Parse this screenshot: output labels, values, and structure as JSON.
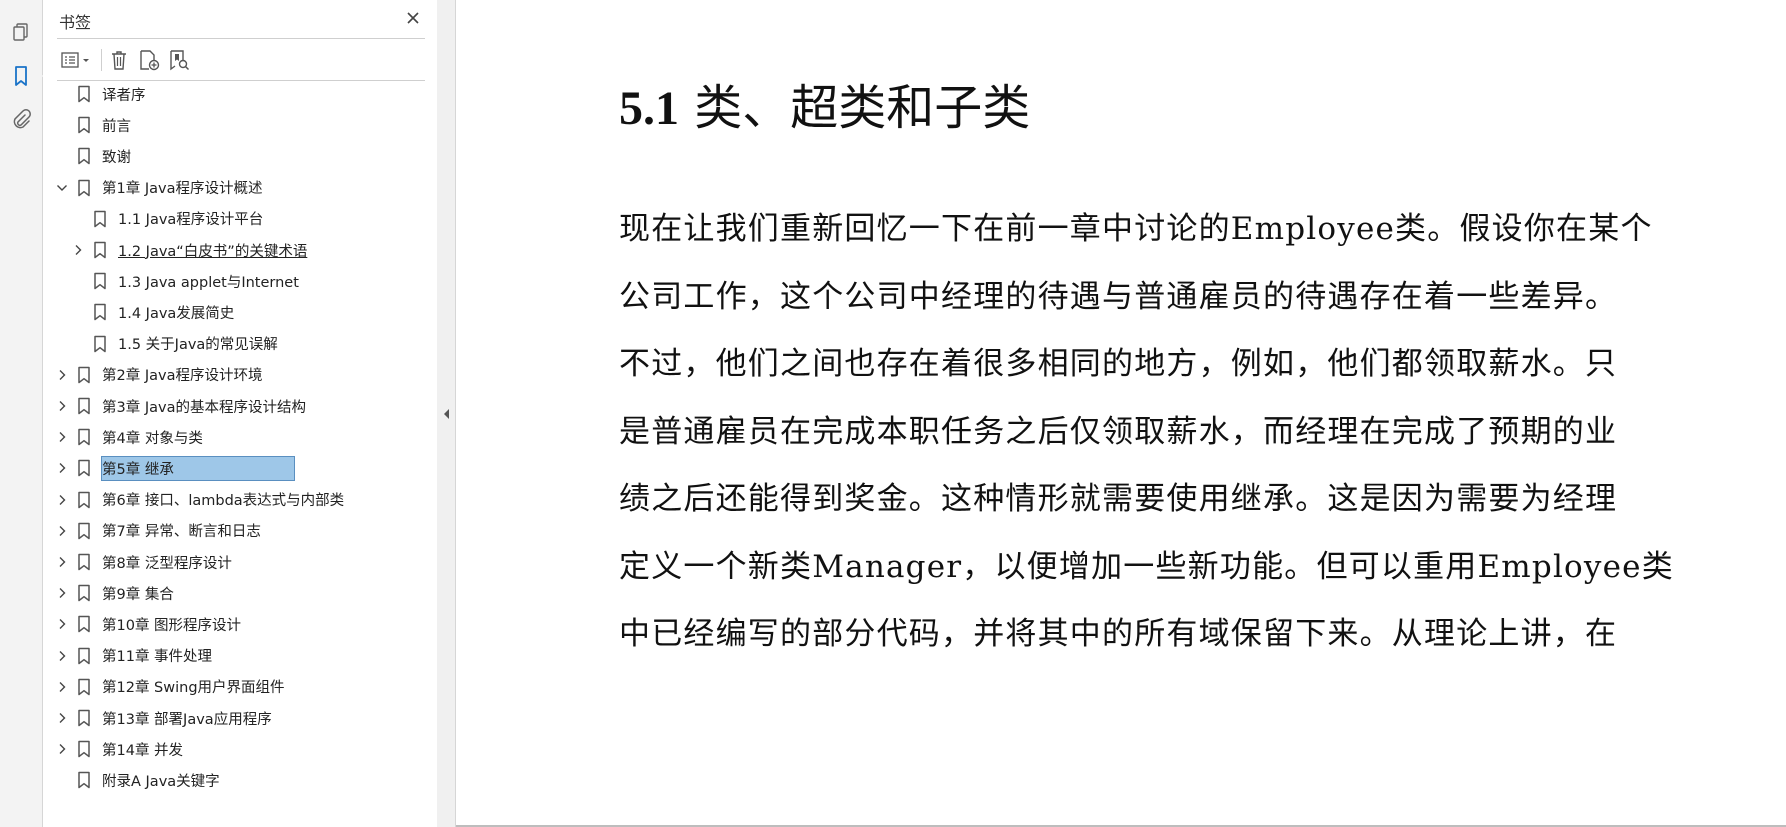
{
  "panel": {
    "title": "书签",
    "bookmarks": [
      {
        "label": "译者序",
        "level": 0,
        "expander": "none"
      },
      {
        "label": "前言",
        "level": 0,
        "expander": "none"
      },
      {
        "label": "致谢",
        "level": 0,
        "expander": "none"
      },
      {
        "label": "第1章 Java程序设计概述",
        "level": 0,
        "expander": "expanded"
      },
      {
        "label": "1.1 Java程序设计平台",
        "level": 1,
        "expander": "none"
      },
      {
        "label": "1.2 Java“白皮书”的关键术语",
        "level": 1,
        "expander": "collapsed",
        "underlined": true
      },
      {
        "label": "1.3 Java applet与Internet",
        "level": 1,
        "expander": "none"
      },
      {
        "label": "1.4 Java发展简史",
        "level": 1,
        "expander": "none"
      },
      {
        "label": "1.5 关于Java的常见误解",
        "level": 1,
        "expander": "none"
      },
      {
        "label": "第2章 Java程序设计环境",
        "level": 0,
        "expander": "collapsed"
      },
      {
        "label": "第3章 Java的基本程序设计结构",
        "level": 0,
        "expander": "collapsed"
      },
      {
        "label": "第4章 对象与类",
        "level": 0,
        "expander": "collapsed"
      },
      {
        "label": "第5章 继承",
        "level": 0,
        "expander": "collapsed",
        "selected": true
      },
      {
        "label": "第6章 接口、lambda表达式与内部类",
        "level": 0,
        "expander": "collapsed"
      },
      {
        "label": "第7章 异常、断言和日志",
        "level": 0,
        "expander": "collapsed"
      },
      {
        "label": "第8章 泛型程序设计",
        "level": 0,
        "expander": "collapsed"
      },
      {
        "label": "第9章 集合",
        "level": 0,
        "expander": "collapsed"
      },
      {
        "label": "第10章 图形程序设计",
        "level": 0,
        "expander": "collapsed"
      },
      {
        "label": "第11章 事件处理",
        "level": 0,
        "expander": "collapsed"
      },
      {
        "label": "第12章 Swing用户界面组件",
        "level": 0,
        "expander": "collapsed"
      },
      {
        "label": "第13章 部署Java应用程序",
        "level": 0,
        "expander": "collapsed"
      },
      {
        "label": "第14章 并发",
        "level": 0,
        "expander": "collapsed"
      },
      {
        "label": "附录A Java关键字",
        "level": 0,
        "expander": "none"
      }
    ]
  },
  "document": {
    "heading_number": "5.1",
    "heading_text": "类、超类和子类",
    "paragraph_lines": [
      "现在让我们重新回忆一下在前一章中讨论的Employee类。假设你在某个",
      "公司工作，这个公司中经理的待遇与普通雇员的待遇存在着一些差异。",
      "不过，他们之间也存在着很多相同的地方，例如，他们都领取薪水。只",
      "是普通雇员在完成本职任务之后仅领取薪水，而经理在完成了预期的业",
      "绩之后还能得到奖金。这种情形就需要使用继承。这是因为需要为经理",
      "定义一个新类Manager，以便增加一些新功能。但可以重用Employee类",
      "中已经编写的部分代码，并将其中的所有域保留下来。从理论上讲，在"
    ]
  },
  "icons": {
    "rail": [
      "page-thumbnails-icon",
      "bookmarks-icon",
      "attachments-icon"
    ],
    "toolbar": [
      "options-menu-icon",
      "delete-bookmark-icon",
      "new-bookmark-icon",
      "bookmark-search-icon"
    ]
  },
  "colors": {
    "accent": "#1a73c8",
    "selection": "#9ec7e8"
  }
}
